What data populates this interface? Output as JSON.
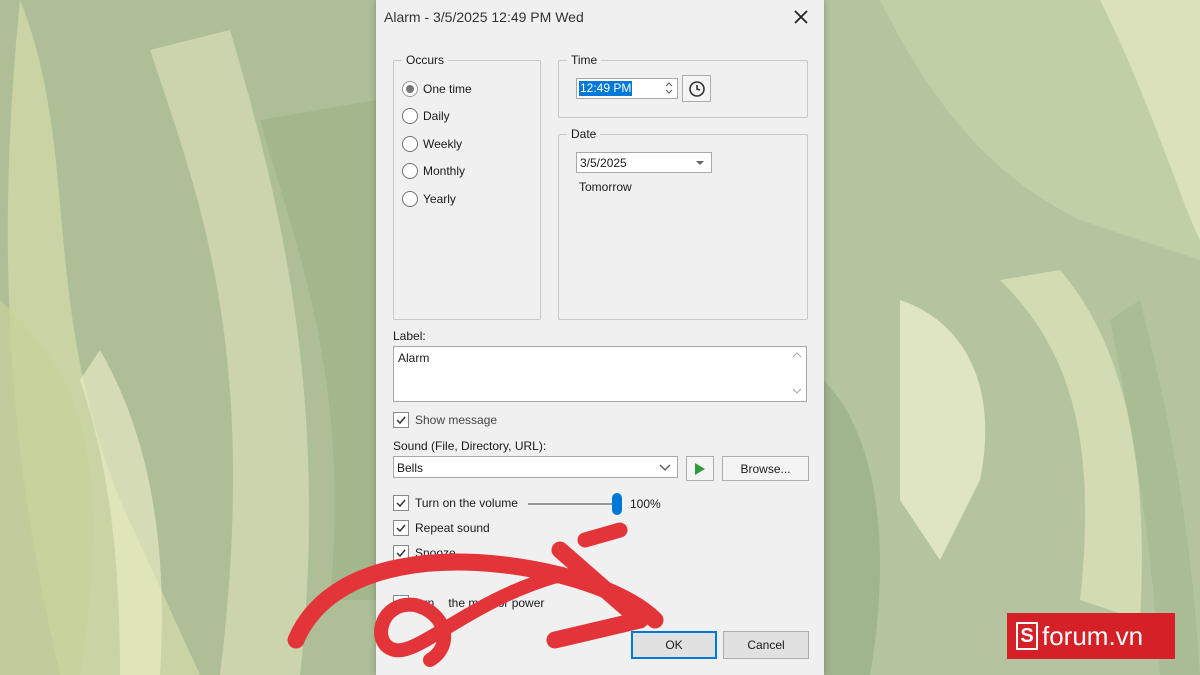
{
  "dialog": {
    "title": "Alarm - 3/5/2025 12:49 PM Wed"
  },
  "occurs": {
    "label": "Occurs",
    "options": [
      "One time",
      "Daily",
      "Weekly",
      "Monthly",
      "Yearly"
    ],
    "selected": "One time"
  },
  "time": {
    "label": "Time",
    "value": "12:49 PM"
  },
  "date": {
    "label": "Date",
    "value": "3/5/2025",
    "relative": "Tomorrow"
  },
  "label_field": {
    "label": "Label:",
    "value": "Alarm"
  },
  "show_message": {
    "label": "Show message",
    "checked": true
  },
  "sound": {
    "label": "Sound (File, Directory, URL):",
    "value": "Bells",
    "browse_label": "Browse..."
  },
  "volume": {
    "label": "Turn on the volume",
    "checked": true,
    "level": 1.0,
    "level_text": "100%"
  },
  "repeat_sound": {
    "label": "Repeat sound",
    "checked": true
  },
  "snooze": {
    "label": "Snooze",
    "checked": true
  },
  "monitor": {
    "label_visible": "urn",
    "label_visible_2": "the monitor power"
  },
  "buttons": {
    "ok": "OK",
    "cancel": "Cancel"
  },
  "watermark": {
    "mark": "S",
    "text": "forum.vn"
  },
  "colors": {
    "accent": "#0078d7",
    "arrow": "#e3343a",
    "logo": "#d42026",
    "play": "#2e9b3e"
  }
}
